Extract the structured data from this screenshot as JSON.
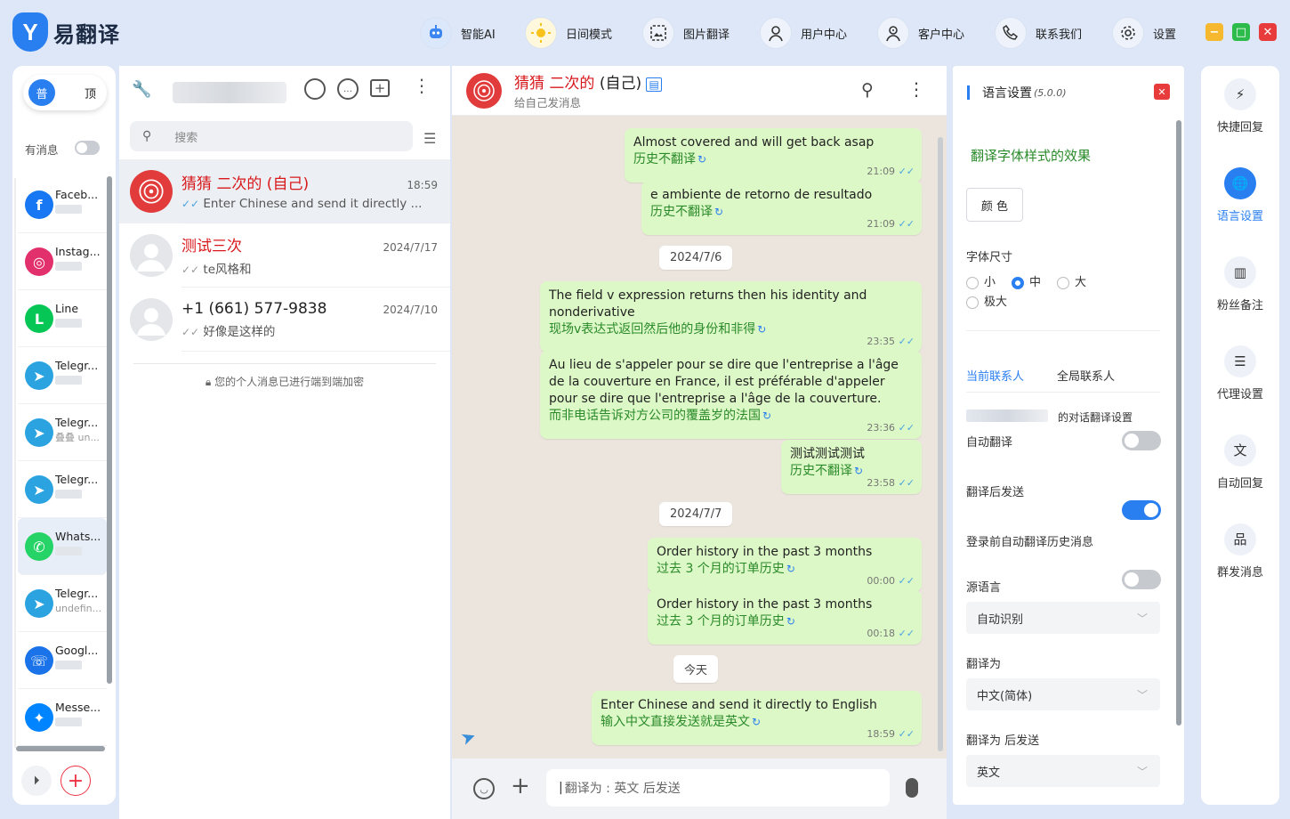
{
  "app": {
    "logo_letter": "Y",
    "name": "易翻译"
  },
  "nav": [
    {
      "label": "智能AI",
      "icon": "robot-icon"
    },
    {
      "label": "日间模式",
      "icon": "sun-icon"
    },
    {
      "label": "图片翻译",
      "icon": "image-translate-icon"
    },
    {
      "label": "用户中心",
      "icon": "user-icon"
    },
    {
      "label": "客户中心",
      "icon": "customer-icon"
    },
    {
      "label": "联系我们",
      "icon": "phone-icon"
    },
    {
      "label": "设置",
      "icon": "gear-icon"
    }
  ],
  "window_buttons": {
    "minimize": "−",
    "maximize": "□",
    "close": "✕",
    "colors": {
      "minimize": "#f5b82e",
      "maximize": "#2dbb4c",
      "close": "#e83b3b"
    }
  },
  "rail": {
    "pill_left": "普",
    "pill_right": "顶",
    "unread_label": "有消息",
    "apps": [
      {
        "name": "Faceb...",
        "color": "#1877f2",
        "glyph": "f",
        "icon": "facebook-icon",
        "sub": ""
      },
      {
        "name": "Instag...",
        "color": "#e1306c",
        "glyph": "◎",
        "icon": "instagram-icon",
        "sub": ""
      },
      {
        "name": "Line",
        "color": "#06c755",
        "glyph": "L",
        "icon": "line-icon",
        "sub": ""
      },
      {
        "name": "Telegr...",
        "color": "#2aa3e0",
        "glyph": "➤",
        "icon": "telegram-icon",
        "sub": ""
      },
      {
        "name": "Telegr...",
        "color": "#2aa3e0",
        "glyph": "➤",
        "icon": "telegram-icon",
        "sub": "叠叠 un..."
      },
      {
        "name": "Telegr...",
        "color": "#2aa3e0",
        "glyph": "➤",
        "icon": "telegram-icon",
        "sub": ""
      },
      {
        "name": "Whats...",
        "color": "#25d366",
        "glyph": "✆",
        "icon": "whatsapp-icon",
        "sub": ""
      },
      {
        "name": "Telegr...",
        "color": "#2aa3e0",
        "glyph": "➤",
        "icon": "telegram-icon",
        "sub": "undefin..."
      },
      {
        "name": "Googl...",
        "color": "#1a73e8",
        "glyph": "☏",
        "icon": "google-voice-icon",
        "sub": ""
      },
      {
        "name": "Messe...",
        "color": "#0084ff",
        "glyph": "✦",
        "icon": "messenger-icon",
        "sub": ""
      }
    ]
  },
  "chatlist": {
    "search_placeholder": "搜索",
    "chats": [
      {
        "name": "猜猜 二次的 (自己)",
        "time": "18:59",
        "msg": "Enter Chinese and send it directly ...",
        "red": true,
        "avatar_red": true
      },
      {
        "name": "测试三次",
        "time": "2024/7/17",
        "msg": "te风格和",
        "red": true,
        "avatar_red": false
      },
      {
        "name": "+1 (661) 577-9838",
        "time": "2024/7/10",
        "msg": "好像是这样的",
        "red": false,
        "avatar_red": false
      }
    ],
    "encryption_note": "您的个人消息已进行端到端加密"
  },
  "conversation": {
    "title": "猜猜 二次的",
    "title_suffix": "(自己)",
    "subtitle": "给自己发消息",
    "messages": [
      {
        "type": "msg",
        "text": "Almost covered and will get back asap",
        "trans": "历史不翻译",
        "time": "21:09"
      },
      {
        "type": "msg",
        "text": "e ambiente de retorno de resultado",
        "trans": "历史不翻译",
        "time": "21:09"
      },
      {
        "type": "date",
        "text": "2024/7/6"
      },
      {
        "type": "msg",
        "text": "The field v expression returns then his identity and nonderivative",
        "trans": "现场v表达式返回然后他的身份和非得",
        "time": "23:35"
      },
      {
        "type": "msg",
        "text": "Au lieu de s'appeler pour se dire que l'entreprise a l'âge de la couverture en France, il est préférable d'appeler pour se dire que l'entreprise a l'âge de la couverture.",
        "trans": "而非电话告诉对方公司的覆盖岁的法国",
        "time": "23:36"
      },
      {
        "type": "msg",
        "text": "测试测试测试",
        "trans": "历史不翻译",
        "time": "23:58"
      },
      {
        "type": "date",
        "text": "2024/7/7"
      },
      {
        "type": "msg",
        "text": "Order history in the past 3 months",
        "trans": "过去 3 个月的订单历史",
        "time": "00:00"
      },
      {
        "type": "msg",
        "text": "Order history in the past 3 months",
        "trans": "过去 3 个月的订单历史",
        "time": "00:18"
      },
      {
        "type": "date",
        "text": "今天"
      },
      {
        "type": "msg",
        "text": "Enter Chinese and send it directly to English",
        "trans": "输入中文直接发送就是英文",
        "time": "18:59"
      }
    ],
    "composer_placeholder": "翻译为 : 英文 后发送"
  },
  "settings": {
    "title": "语言设置",
    "version": "(5.0.0)",
    "font_effect": "翻译字体样式的效果",
    "color_button": "颜 色",
    "font_size_label": "字体尺寸",
    "font_sizes": [
      "小",
      "中",
      "大",
      "极大"
    ],
    "font_size_selected": "中",
    "tab_current": "当前联系人",
    "tab_global": "全局联系人",
    "contact_settings_suffix": "的对话翻译设置",
    "auto_translate": {
      "label": "自动翻译",
      "on": false
    },
    "send_after_translate": {
      "label": "翻译后发送",
      "on": true
    },
    "translate_history": {
      "label": "登录前自动翻译历史消息",
      "on": false
    },
    "source_lang_label": "源语言",
    "source_lang": "自动识别",
    "target_lang_label": "翻译为",
    "target_lang": "中文(简体)",
    "send_lang_label": "翻译为 后发送",
    "send_lang": "英文"
  },
  "tools": [
    {
      "label": "快捷回复",
      "icon": "quick-reply-icon",
      "glyph": "⚡"
    },
    {
      "label": "语言设置",
      "icon": "globe-icon",
      "glyph": "🌐",
      "selected": true
    },
    {
      "label": "粉丝备注",
      "icon": "notes-icon",
      "glyph": "▥"
    },
    {
      "label": "代理设置",
      "icon": "proxy-icon",
      "glyph": "☰"
    },
    {
      "label": "自动回复",
      "icon": "auto-reply-icon",
      "glyph": "文"
    },
    {
      "label": "群发消息",
      "icon": "broadcast-icon",
      "glyph": "品"
    }
  ],
  "colors": {
    "accent": "#2a7ff0",
    "bubble": "#dcf8c6",
    "name_red": "#d8191c"
  }
}
